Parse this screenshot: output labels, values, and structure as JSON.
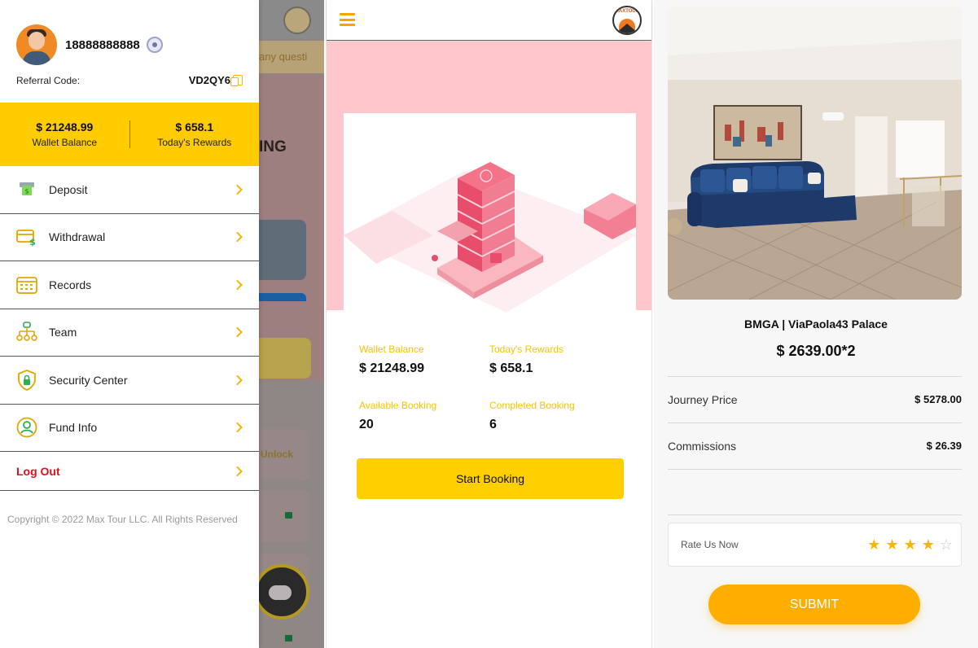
{
  "drawer": {
    "phone": "18888888888",
    "referral_label": "Referral Code:",
    "referral_code": "VD2QY6",
    "wallet_balance": {
      "amount": "$ 21248.99",
      "label": "Wallet Balance"
    },
    "todays_rewards": {
      "amount": "$ 658.1",
      "label": "Today's Rewards"
    },
    "menu": [
      {
        "label": "Deposit",
        "icon": "deposit-icon"
      },
      {
        "label": "Withdrawal",
        "icon": "withdrawal-card-icon"
      },
      {
        "label": "Records",
        "icon": "calendar-icon"
      },
      {
        "label": "Team",
        "icon": "team-tree-icon"
      },
      {
        "label": "Security Center",
        "icon": "shield-lock-icon"
      },
      {
        "label": "Fund Info",
        "icon": "user-circle-icon"
      },
      {
        "label": "Log Out",
        "icon": "chevron-right-icon"
      }
    ],
    "copyright": "Copyright © 2022 Max Tour LLC. All Rights Reserved"
  },
  "background_page": {
    "banner_text": "any questi",
    "heading_fragment": "ING",
    "unlock_label": "Unlock"
  },
  "home": {
    "logo_text": "MAXTOUR",
    "stats": {
      "wallet_balance": {
        "label": "Wallet Balance",
        "value": "$ 21248.99"
      },
      "todays_rewards": {
        "label": "Today's Rewards",
        "value": "$ 658.1"
      },
      "available_booking": {
        "label": "Available Booking",
        "value": "20"
      },
      "completed_booking": {
        "label": "Completed Booking",
        "value": "6"
      }
    },
    "start_button": "Start Booking"
  },
  "booking": {
    "hotel_name": "BMGA | ViaPaola43 Palace",
    "price": "$ 2639.00*2",
    "journey_price": {
      "label": "Journey Price",
      "value": "$ 5278.00"
    },
    "commissions": {
      "label": "Commissions",
      "value": "$ 26.39"
    },
    "rate_label": "Rate Us Now",
    "rating": 4,
    "rating_max": 5,
    "submit": "SUBMIT"
  },
  "colors": {
    "accent_yellow": "#ffcc00",
    "submit_orange": "#ffae00",
    "pink_banner": "#fdc7cb",
    "logout_red": "#e0101c"
  }
}
